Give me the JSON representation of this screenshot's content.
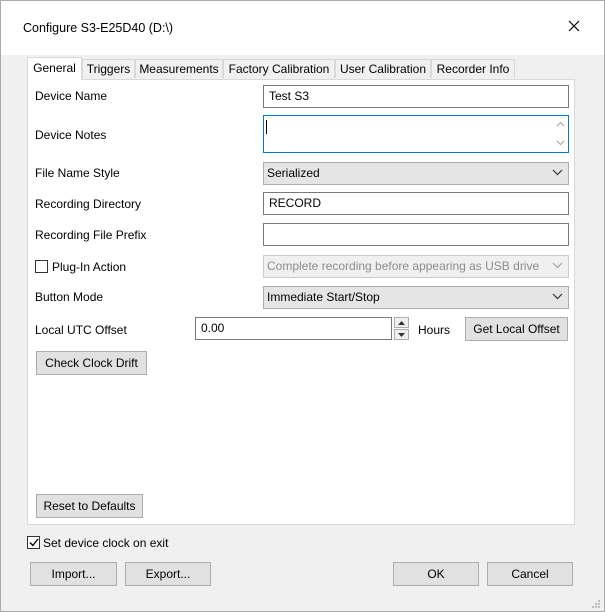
{
  "window": {
    "title": "Configure S3-E25D40 (D:\\)"
  },
  "tabs": [
    {
      "label": "General",
      "active": true
    },
    {
      "label": "Triggers",
      "active": false
    },
    {
      "label": "Measurements",
      "active": false
    },
    {
      "label": "Factory Calibration",
      "active": false
    },
    {
      "label": "User Calibration",
      "active": false
    },
    {
      "label": "Recorder Info",
      "active": false
    }
  ],
  "general": {
    "device_name": {
      "label": "Device Name",
      "value": "Test S3"
    },
    "device_notes": {
      "label": "Device Notes",
      "value": ""
    },
    "file_name_style": {
      "label": "File Name Style",
      "value": "Serialized"
    },
    "recording_directory": {
      "label": "Recording Directory",
      "value": "RECORD"
    },
    "recording_file_prefix": {
      "label": "Recording File Prefix",
      "value": ""
    },
    "plug_in_action": {
      "label": "Plug-In Action",
      "checked": false,
      "value": "Complete recording before appearing as USB drive"
    },
    "button_mode": {
      "label": "Button Mode",
      "value": "Immediate Start/Stop"
    },
    "local_utc_offset": {
      "label": "Local UTC Offset",
      "value": "0.00",
      "unit": "Hours"
    },
    "get_local_offset_label": "Get Local Offset",
    "check_clock_drift_label": "Check Clock Drift",
    "reset_defaults_label": "Reset to Defaults"
  },
  "footer": {
    "set_clock_label": "Set device clock on exit",
    "set_clock_checked": true,
    "import_label": "Import...",
    "export_label": "Export...",
    "ok_label": "OK",
    "cancel_label": "Cancel"
  }
}
